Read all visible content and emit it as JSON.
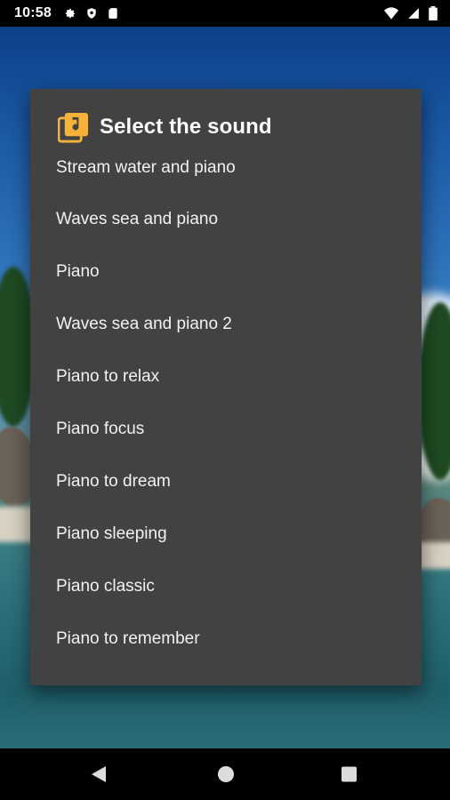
{
  "status_bar": {
    "time": "10:58",
    "left_icons": [
      "gear-icon",
      "shield-icon",
      "sd-card-icon"
    ],
    "right_icons": [
      "wifi-icon",
      "signal-icon",
      "battery-icon"
    ]
  },
  "dialog": {
    "title": "Select the sound",
    "icon": "music-library-icon",
    "icon_color": "#f6b23a",
    "items": [
      {
        "label": "Stream water and piano"
      },
      {
        "label": "Waves sea and piano"
      },
      {
        "label": "Piano"
      },
      {
        "label": "Waves sea and piano 2"
      },
      {
        "label": "Piano to relax"
      },
      {
        "label": "Piano focus"
      },
      {
        "label": "Piano to dream"
      },
      {
        "label": "Piano sleeping"
      },
      {
        "label": "Piano classic"
      },
      {
        "label": "Piano to remember"
      }
    ]
  },
  "nav_bar": {
    "buttons": [
      "back-icon",
      "home-icon",
      "recents-icon"
    ]
  },
  "colors": {
    "dialog_bg": "#424242",
    "text": "#f2f2f2",
    "accent": "#f6b23a"
  }
}
